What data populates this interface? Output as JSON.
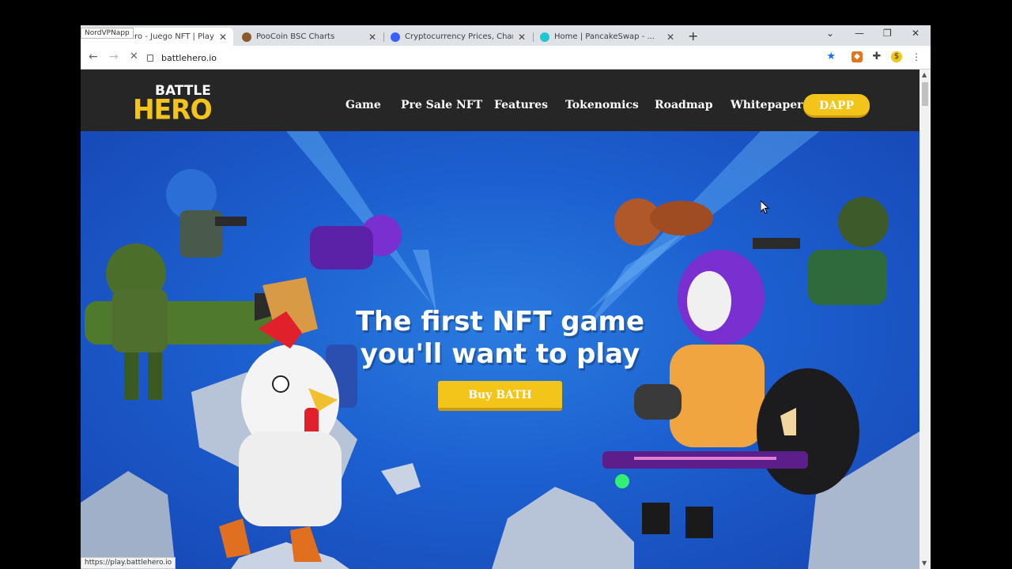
{
  "browser": {
    "overlay_label": "NordVPNapp",
    "tabs": [
      {
        "title": "ero - Juego NFT | Play to",
        "active": true,
        "favicon_color": "#f3c51a"
      },
      {
        "title": "PooCoin BSC Charts",
        "active": false,
        "favicon_color": "#8b5a2b"
      },
      {
        "title": "Cryptocurrency Prices, Charts An",
        "active": false,
        "favicon_color": "#3861fb"
      },
      {
        "title": "Home | PancakeSwap - ...",
        "active": false,
        "favicon_color": "#1fc7d4"
      }
    ],
    "new_tab_symbol": "+",
    "tab_close_symbol": "✕",
    "window_buttons": {
      "tabsearch": "⌄",
      "minimize": "—",
      "restore": "❐",
      "close": "✕"
    },
    "url": "battlehero.io",
    "status_url": "https://play.battlehero.io"
  },
  "site": {
    "logo_top": "BATTLE",
    "logo_bottom": "HERO",
    "nav": [
      "Game",
      "Pre Sale NFT",
      "Features",
      "Tokenomics",
      "Roadmap",
      "Whitepaper"
    ],
    "dapp_label": "DAPP",
    "headline_line1": "The first NFT game",
    "headline_line2": "you'll want to play",
    "buy_label": "Buy BATH"
  },
  "colors": {
    "accent_yellow": "#f3c51a",
    "header_bg": "#262626",
    "hero_blue": "#1c5fcf"
  }
}
